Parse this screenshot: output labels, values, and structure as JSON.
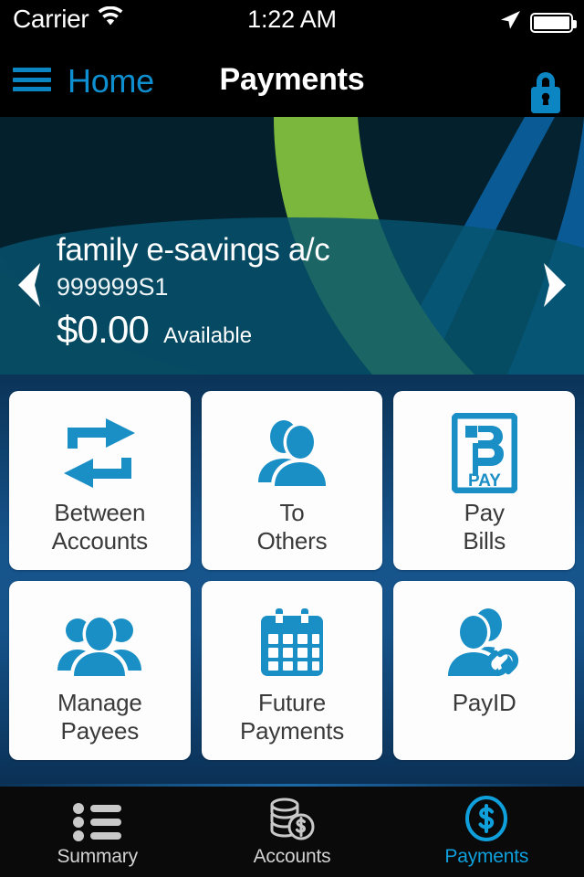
{
  "status_bar": {
    "carrier": "Carrier",
    "wifi_icon": "wifi-icon",
    "time": "1:22 AM",
    "location_icon": "location-arrow-icon",
    "battery_icon": "battery-full-icon"
  },
  "nav": {
    "menu_icon": "hamburger-menu-icon",
    "back_label": "Home",
    "title": "Payments",
    "lock_icon": "padlock-locked-icon"
  },
  "account_card": {
    "name": "family e-savings a/c",
    "number": "999999S1",
    "balance": "$0.00",
    "balance_label": "Available",
    "prev_icon": "chevron-left-icon",
    "next_icon": "chevron-right-icon"
  },
  "tiles": [
    {
      "id": "between-accounts",
      "icon": "transfer-arrows-icon",
      "line1": "Between",
      "line2": "Accounts"
    },
    {
      "id": "to-others",
      "icon": "two-people-icon",
      "line1": "To",
      "line2": "Others"
    },
    {
      "id": "pay-bills",
      "icon": "bpay-logo-icon",
      "line1": "Pay",
      "line2": "Bills"
    },
    {
      "id": "manage-payees",
      "icon": "three-people-icon",
      "line1": "Manage",
      "line2": "Payees"
    },
    {
      "id": "future-payments",
      "icon": "calendar-icon",
      "line1": "Future",
      "line2": "Payments"
    },
    {
      "id": "payid",
      "icon": "person-link-icon",
      "line1": "PayID",
      "line2": ""
    }
  ],
  "tabs": [
    {
      "id": "summary",
      "label": "Summary",
      "icon": "list-bullets-icon",
      "active": false
    },
    {
      "id": "accounts",
      "label": "Accounts",
      "icon": "coins-dollar-icon",
      "active": false
    },
    {
      "id": "payments",
      "label": "Payments",
      "icon": "dollar-circle-icon",
      "active": true
    }
  ],
  "colors": {
    "accent_blue": "#0FA0DC",
    "brand_green": "#7AB73C",
    "arc_blue": "#0A5A96",
    "card_teal": "#06546E",
    "grid_blue": "#16548C",
    "tile_white": "#FDFDFD",
    "text_dark": "#3A3A3A"
  }
}
